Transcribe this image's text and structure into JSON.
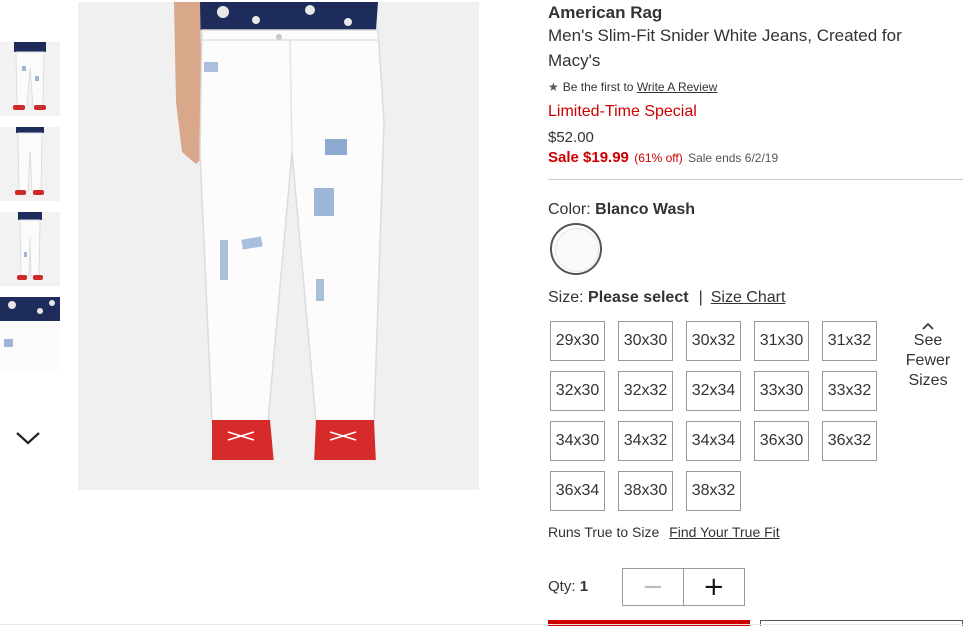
{
  "product": {
    "brand": "American Rag",
    "title": "Men's Slim-Fit Snider White Jeans, Created for Macy's",
    "review_prefix": "Be the first to",
    "review_link": "Write A Review",
    "review_icon": "star-icon",
    "promo": "Limited-Time Special",
    "original_price": "$52.00",
    "sale_price": "Sale $19.99",
    "discount": "(61% off)",
    "sale_ends": "Sale ends 6/2/19"
  },
  "color": {
    "label": "Color:",
    "selected": "Blanco Wash"
  },
  "size": {
    "label": "Size:",
    "selected": "Please select",
    "separator": "|",
    "chart_link": "Size Chart",
    "options": [
      "29x30",
      "30x30",
      "30x32",
      "31x30",
      "31x32",
      "32x30",
      "32x32",
      "32x34",
      "33x30",
      "33x32",
      "34x30",
      "34x32",
      "34x34",
      "36x30",
      "36x32",
      "36x34",
      "38x30",
      "38x32"
    ],
    "see_fewer": [
      "See",
      "Fewer",
      "Sizes"
    ]
  },
  "fit": {
    "label": "Runs True to Size",
    "link": "Find Your True Fit"
  },
  "quantity": {
    "label": "Qty:",
    "value": "1",
    "minus": "−",
    "plus": "+"
  },
  "colors": {
    "sale_red": "#cc0000",
    "text": "#333333",
    "border": "#999999"
  }
}
